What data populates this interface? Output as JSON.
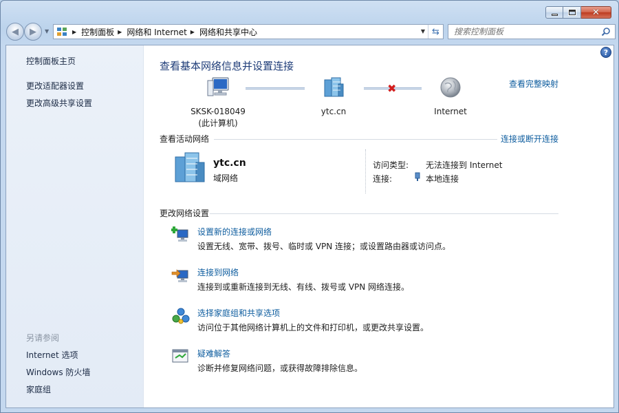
{
  "window": {
    "caption": {
      "minimize": "—",
      "maximize": "▢",
      "close": "✕"
    }
  },
  "navigation": {
    "breadcrumbs": [
      "控制面板",
      "网络和 Internet",
      "网络和共享中心"
    ],
    "search_placeholder": "搜索控制面板"
  },
  "sidebar": {
    "links": [
      "控制面板主页",
      "更改适配器设置",
      "更改高级共享设置"
    ],
    "see_also_heading": "另请参阅",
    "see_also": [
      "Internet 选项",
      "Windows 防火墙",
      "家庭组"
    ]
  },
  "main": {
    "title": "查看基本网络信息并设置连接",
    "full_map_link": "查看完整映射",
    "map_nodes": [
      {
        "line1": "SKSK-018049",
        "line2": "(此计算机)",
        "icon": "computer-icon"
      },
      {
        "line1": "ytc.cn",
        "line2": "",
        "icon": "domain-network-icon"
      },
      {
        "line1": "Internet",
        "line2": "",
        "icon": "globe-icon"
      }
    ],
    "map_link_status": [
      "connected",
      "disconnected"
    ],
    "active_networks": {
      "heading": "查看活动网络",
      "connect_link": "连接或断开连接",
      "network_name": "ytc.cn",
      "network_type": "域网络",
      "access_type_label": "访问类型:",
      "access_type_value": "无法连接到 Internet",
      "connections_label": "连接:",
      "connections_value": "本地连接"
    },
    "change_settings": {
      "heading": "更改网络设置",
      "tasks": [
        {
          "title": "设置新的连接或网络",
          "desc": "设置无线、宽带、拨号、临时或 VPN 连接；或设置路由器或访问点。",
          "icon": "new-connection-icon"
        },
        {
          "title": "连接到网络",
          "desc": "连接到或重新连接到无线、有线、拨号或 VPN 网络连接。",
          "icon": "connect-network-icon"
        },
        {
          "title": "选择家庭组和共享选项",
          "desc": "访问位于其他网络计算机上的文件和打印机，或更改共享设置。",
          "icon": "homegroup-icon"
        },
        {
          "title": "疑难解答",
          "desc": "诊断并修复网络问题，或获得故障排除信息。",
          "icon": "troubleshoot-icon"
        }
      ]
    }
  },
  "colors": {
    "link": "#0d5c9e",
    "title": "#1e3c78",
    "error": "#d21d1d"
  }
}
